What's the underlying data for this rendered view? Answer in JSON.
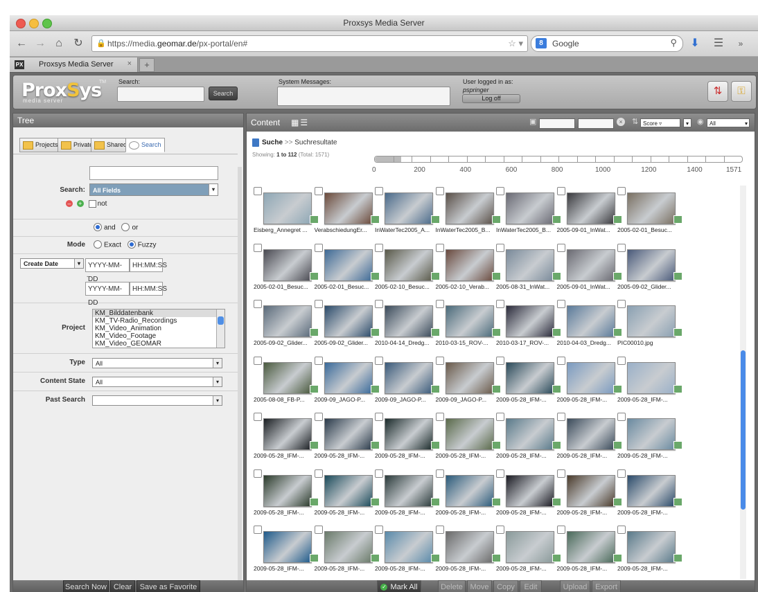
{
  "window": {
    "title": "Proxsys Media Server"
  },
  "browser": {
    "url_prefix": "https://media.",
    "url_domain": "geomar.de",
    "url_suffix": "/px-portal/en#",
    "search_engine": "Google",
    "tab_icon": "PX",
    "tab_label": "Proxsys Media Server"
  },
  "header": {
    "logo_main_pre": "Prox",
    "logo_main_hl": "S",
    "logo_main_post": "ys",
    "logo_sub": "media server",
    "logo_ver": "TM",
    "search_label": "Search:",
    "search_button": "Search",
    "system_messages_label": "System Messages:",
    "user_label": "User logged in as:",
    "username": "pspringer",
    "logoff_button": "Log off"
  },
  "tree": {
    "title": "Tree",
    "tabs": [
      "Projects",
      "Private",
      "Shared",
      "Search"
    ],
    "search_label": "Search:",
    "search_field_value": "All Fields",
    "not_label": "not",
    "and_label": "and",
    "or_label": "or",
    "mode_label": "Mode",
    "exact_label": "Exact",
    "fuzzy_label": "Fuzzy",
    "date_field": "Create Date",
    "date_placeholder": "YYYY-MM-DD",
    "time_placeholder": "HH:MM:SS",
    "date_dash": "-",
    "project_label": "Project",
    "projects": [
      "KM_Bilddatenbank",
      "KM_TV-Radio_Recordings",
      "KM_Video_Animation",
      "KM_Video_Footage",
      "KM_Video_GEOMAR"
    ],
    "type_label": "Type",
    "type_value": "All",
    "content_state_label": "Content State",
    "content_state_value": "All",
    "past_search_label": "Past Search",
    "past_search_value": "",
    "buttons": {
      "search_now": "Search Now",
      "clear": "Clear",
      "save_favorite": "Save as Favorite"
    }
  },
  "content": {
    "title": "Content",
    "sort_value": "Score ▿",
    "filter_value": "All",
    "breadcrumb_root": "Suche",
    "breadcrumb_sep": ">>",
    "breadcrumb_leaf": "Suchresultate",
    "showing_label": "Showing:",
    "showing_range": "1 to 112",
    "showing_total": "(Total: 1571)",
    "timeline_ticks": [
      "0",
      "200",
      "400",
      "600",
      "800",
      "1000",
      "1200",
      "1400",
      "1571"
    ],
    "items": [
      [
        "Eisberg_Annegret ...",
        "VerabschiedungEr...",
        "InWaterTec2005_A...",
        "InWaterTec2005_B...",
        "InWaterTec2005_B...",
        "2005-09-01_InWat...",
        "2005-02-01_Besuc..."
      ],
      [
        "2005-02-01_Besuc...",
        "2005-02-01_Besuc...",
        "2005-02-10_Besuc...",
        "2005-02-10_Verab...",
        "2005-08-31_InWat...",
        "2005-09-01_InWat...",
        "2005-09-02_Glider..."
      ],
      [
        "2005-09-02_Glider...",
        "2005-09-02_Glider...",
        "2010-04-14_Dredg...",
        "2010-03-15_ROV-...",
        "2010-03-17_ROV-...",
        "2010-04-03_Dredg...",
        "PIC00010.jpg"
      ],
      [
        "2005-08-08_FB-P...",
        "2009-09_JAGO-P...",
        "2009-09_JAGO-P...",
        "2009-09_JAGO-P...",
        "2009-05-28_IFM-...",
        "2009-05-28_IFM-...",
        "2009-05-28_IFM-..."
      ],
      [
        "2009-05-28_IFM-...",
        "2009-05-28_IFM-...",
        "2009-05-28_IFM-...",
        "2009-05-28_IFM-...",
        "2009-05-28_IFM-...",
        "2009-05-28_IFM-...",
        "2009-05-28_IFM-..."
      ],
      [
        "2009-05-28_IFM-...",
        "2009-05-28_IFM-...",
        "2009-05-28_IFM-...",
        "2009-05-28_IFM-...",
        "2009-05-28_IFM-...",
        "2009-05-28_IFM-...",
        "2009-05-28_IFM-..."
      ],
      [
        "2009-05-28_IFM-...",
        "2009-05-28_IFM-...",
        "2009-05-28_IFM-...",
        "2009-05-28_IFM-...",
        "2009-05-28_IFM-...",
        "2009-05-28_IFM-...",
        "2009-05-28_IFM-..."
      ]
    ],
    "thumb_colors": [
      [
        "#8ea7b5",
        "#6b4a3a",
        "#4a6a8a",
        "#5a5048",
        "#6a6a74",
        "#3a3a3e",
        "#7a7062"
      ],
      [
        "#4a4a52",
        "#3e6a96",
        "#5a5a4a",
        "#6a4a3e",
        "#7a8a9a",
        "#6a6a72",
        "#4a5a7a"
      ],
      [
        "#5a6a7a",
        "#2a4a6a",
        "#3a4a5a",
        "#4a6a7a",
        "#2a2a3a",
        "#5a7a9a",
        "#8aa0b2"
      ],
      [
        "#4a5a3e",
        "#3a6a9a",
        "#3a5a7a",
        "#6a5a4a",
        "#2a4a5a",
        "#7a9ac0",
        "#9ab0c8"
      ],
      [
        "#1a1e22",
        "#2a3a4a",
        "#1a2a2a",
        "#5a6a4a",
        "#5a7a8a",
        "#3a4a5a",
        "#6a8aa0"
      ],
      [
        "#2a3a2a",
        "#1a4a5a",
        "#2a3a3a",
        "#2a5a7a",
        "#1a1a22",
        "#4a3a2a",
        "#2a4a6a"
      ],
      [
        "#1e5a8a",
        "#6a7a6a",
        "#5a8aaa",
        "#6a6a6a",
        "#8a9a9a",
        "#4a6a5a",
        "#5a7a8a"
      ]
    ],
    "bottom_buttons": {
      "mark_all": "Mark All",
      "delete": "Delete",
      "move": "Move",
      "copy": "Copy",
      "edit": "Edit",
      "upload": "Upload",
      "export": "Export"
    }
  }
}
